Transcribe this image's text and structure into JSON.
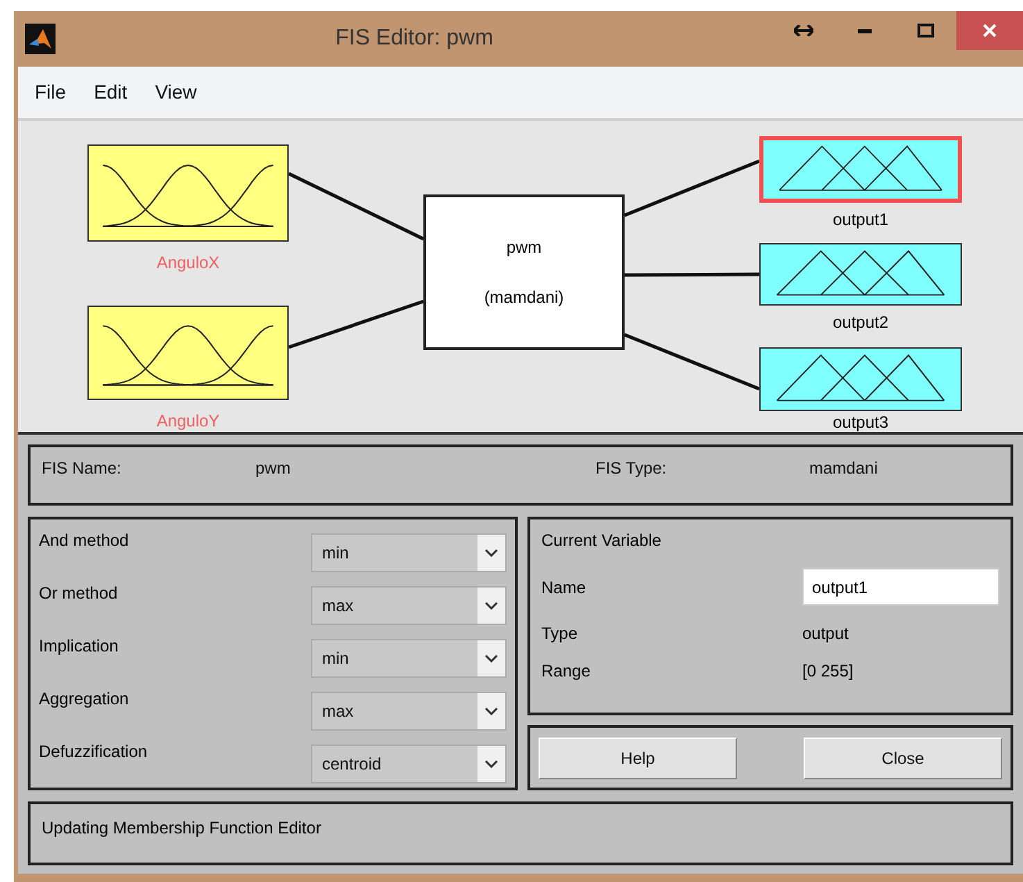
{
  "window": {
    "title": "FIS Editor: pwm"
  },
  "menu": [
    "File",
    "Edit",
    "View"
  ],
  "diagram": {
    "inputs": [
      {
        "label": "AnguloX",
        "selected": false
      },
      {
        "label": "AnguloY",
        "selected": false
      }
    ],
    "system": {
      "name": "pwm",
      "type": "(mamdani)"
    },
    "outputs": [
      {
        "label": "output1",
        "selected": true
      },
      {
        "label": "output2",
        "selected": false
      },
      {
        "label": "output3",
        "selected": false
      }
    ]
  },
  "fis": {
    "name_label": "FIS Name:",
    "name": "pwm",
    "type_label": "FIS Type:",
    "type": "mamdani"
  },
  "methods": [
    {
      "label": "And method",
      "value": "min"
    },
    {
      "label": "Or method",
      "value": "max"
    },
    {
      "label": "Implication",
      "value": "min"
    },
    {
      "label": "Aggregation",
      "value": "max"
    },
    {
      "label": "Defuzzification",
      "value": "centroid"
    }
  ],
  "current_variable": {
    "title": "Current Variable",
    "name_label": "Name",
    "name": "output1",
    "type_label": "Type",
    "type": "output",
    "range_label": "Range",
    "range": "[0 255]"
  },
  "buttons": [
    "Help",
    "Close"
  ],
  "status": "Updating Membership Function Editor"
}
